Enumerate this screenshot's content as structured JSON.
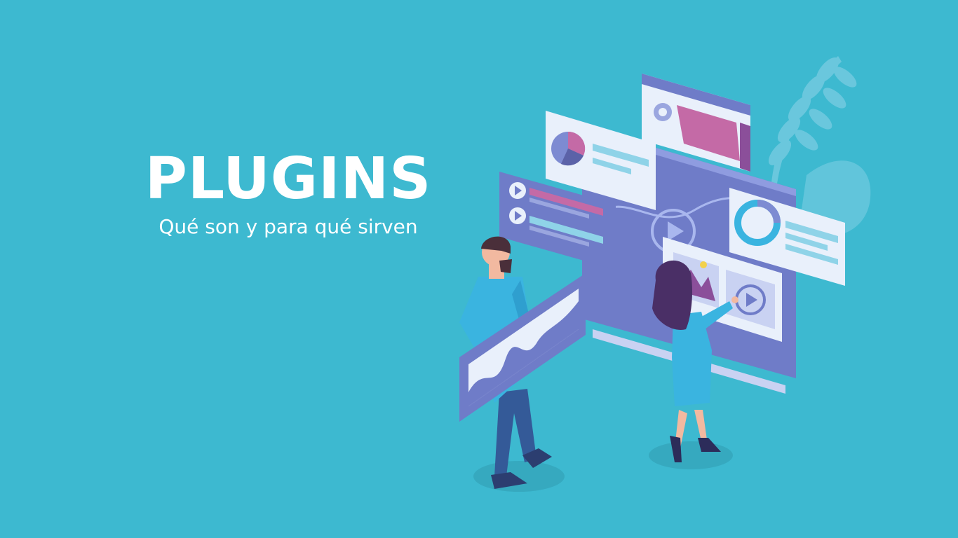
{
  "hero": {
    "title": "PLUGINS",
    "subtitle": "Qué son y para qué sirven"
  },
  "colors": {
    "background": "#3db9d0",
    "panel": "#7d8bd2",
    "panel_dark": "#5b62a8",
    "card": "#e9f0fb",
    "accent_pink": "#c46aa6",
    "accent_cyan": "#3ab4e0",
    "text": "#ffffff"
  },
  "illustration": {
    "figures": [
      "man-holding-chart",
      "woman-pointing-at-screen"
    ],
    "icons": [
      "pie-chart-icon",
      "donut-chart-icon",
      "play-icon",
      "folder-icon",
      "image-icon",
      "wave-chart-icon"
    ]
  }
}
